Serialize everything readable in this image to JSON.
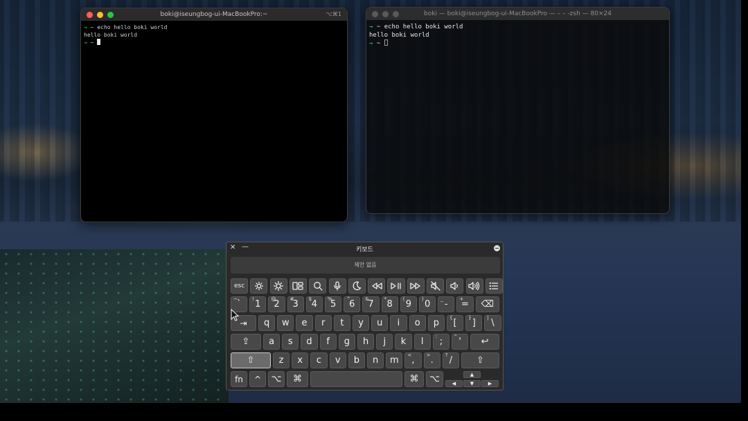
{
  "desktop": {
    "wallpaper": "night city skyline by the sea"
  },
  "terminal_left": {
    "title": "boki@iseungbog-ui-MacBookPro:~",
    "shortcut": "⌥⌘1",
    "lines": [
      {
        "prompt": "→",
        "cwd": "~",
        "text": "echo hello boki world"
      },
      {
        "output": "hello boki world"
      },
      {
        "prompt": "→",
        "cwd": "~",
        "text": ""
      }
    ]
  },
  "terminal_right": {
    "title": "boki — boki@iseungbog-ui-MacBookPro — – – -zsh — 80×24",
    "lines": [
      {
        "prompt": "→",
        "cwd": "~",
        "text": "echo hello boki world"
      },
      {
        "output": "hello boki world"
      },
      {
        "prompt": "→",
        "cwd": "~",
        "text": ""
      }
    ]
  },
  "keyboard": {
    "title": "키보드",
    "suggestion": "제안 없음",
    "fn_row": [
      "esc",
      "brightness-down-icon",
      "brightness-up-icon",
      "mission-control-icon",
      "spotlight-icon",
      "dictation-icon",
      "do-not-disturb-icon",
      "rewind-icon",
      "play-pause-icon",
      "fast-forward-icon",
      "mute-icon",
      "volume-down-icon",
      "volume-up-icon",
      "menu-icon"
    ],
    "row1": [
      {
        "main": "`",
        "sub": "~"
      },
      {
        "main": "1",
        "sub": "!"
      },
      {
        "main": "2",
        "sub": "@"
      },
      {
        "main": "3",
        "sub": "#"
      },
      {
        "main": "4",
        "sub": "$"
      },
      {
        "main": "5",
        "sub": "%"
      },
      {
        "main": "6",
        "sub": "^"
      },
      {
        "main": "7",
        "sub": "&"
      },
      {
        "main": "8",
        "sub": "*"
      },
      {
        "main": "9",
        "sub": "("
      },
      {
        "main": "0",
        "sub": ")"
      },
      {
        "main": "-",
        "sub": "_"
      },
      {
        "main": "=",
        "sub": "+"
      }
    ],
    "delete_label": "⌫",
    "tab_label": "⇥",
    "row2": [
      {
        "main": "q"
      },
      {
        "main": "w"
      },
      {
        "main": "e"
      },
      {
        "main": "r"
      },
      {
        "main": "t"
      },
      {
        "main": "y"
      },
      {
        "main": "u"
      },
      {
        "main": "i"
      },
      {
        "main": "o"
      },
      {
        "main": "p"
      },
      {
        "main": "[",
        "sub": "{"
      },
      {
        "main": "]",
        "sub": "}"
      },
      {
        "main": "\\",
        "sub": "|"
      }
    ],
    "caps_label": "⇪",
    "row3": [
      {
        "main": "a"
      },
      {
        "main": "s"
      },
      {
        "main": "d"
      },
      {
        "main": "f"
      },
      {
        "main": "g"
      },
      {
        "main": "h"
      },
      {
        "main": "j"
      },
      {
        "main": "k"
      },
      {
        "main": "l"
      },
      {
        "main": ";",
        "sub": ":"
      },
      {
        "main": "'",
        "sub": "\""
      }
    ],
    "return_label": "↩",
    "shift_label": "⇧",
    "row4": [
      {
        "main": "z"
      },
      {
        "main": "x"
      },
      {
        "main": "c"
      },
      {
        "main": "v"
      },
      {
        "main": "b"
      },
      {
        "main": "n"
      },
      {
        "main": "m"
      },
      {
        "main": ",",
        "sub": "<"
      },
      {
        "main": ".",
        "sub": ">"
      },
      {
        "main": "/",
        "sub": "?"
      }
    ],
    "bottom": {
      "fn": "fn",
      "ctrl": "^",
      "option": "⌥",
      "command": "⌘",
      "command_r": "⌘",
      "option_r": "⌥"
    },
    "arrows": {
      "up": "▲",
      "left": "◀",
      "down": "▼",
      "right": "▶"
    }
  }
}
